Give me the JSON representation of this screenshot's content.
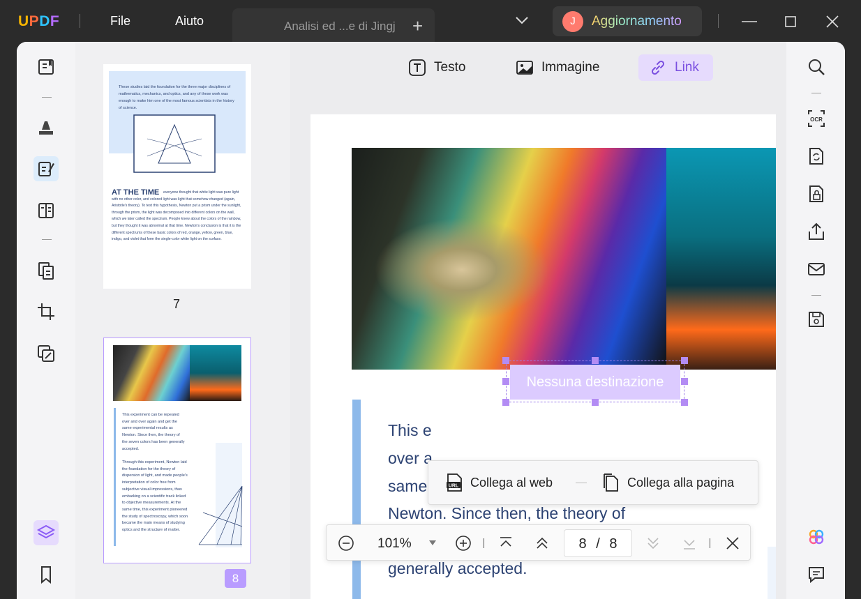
{
  "app": {
    "logo": "UPDF"
  },
  "menu": {
    "file": "File",
    "help": "Aiuto"
  },
  "tab": {
    "title": "Analisi ed ...e di Jingj",
    "add": "+"
  },
  "account": {
    "avatar_initial": "J",
    "upgrade_label": "Aggiornamento"
  },
  "toolbar": {
    "text_label": "Testo",
    "image_label": "Immagine",
    "link_label": "Link"
  },
  "thumbnails": {
    "page7": {
      "number": "7",
      "intro": "These studies laid the foundation for the three major disciplines of mathematics, mechanics, and optics, and any of these work was enough to make him one of the most famous scientists in the history of science.",
      "heading": "AT THE TIME",
      "body": "everyone thought that white light was pure light with no other color, and colored light was light that somehow changed (again, Aristotle's theory). To test this hypothesis, Newton put a prism under the sunlight, through the prism, the light was decomposed into different colors on the wall, which we later called the spectrum. People knew about the colors of the rainbow, but they thought it was abnormal at that time. Newton's conclusion is that it is the different spectrums of these basic colors of red, orange, yellow, green, blue, indigo, and violet that form the single-color white light on the surface."
    },
    "page8": {
      "number": "8",
      "para1": "This experiment can be repeated over and over again and get the same experimental results as Newton. Since then, the theory of the seven colors has been generally accepted.",
      "para2": "Through this experiment, Newton laid the foundation for the theory of dispersion of light, and made people's interpretation of color free from subjective visual impressions, thus embarking on a scientific track linked to objective measurements. At the same time, this experiment pioneered the study of spectroscopy, which soon became the main means of studying optics and the structure of matter."
    }
  },
  "document": {
    "lines": [
      "This e",
      "over a",
      "same experimental results as",
      "Newton. Since then, the theory of",
      "generally accepted."
    ],
    "link_placeholder": "Nessuna destinazione"
  },
  "link_popup": {
    "web": "Collega al web",
    "page": "Collega alla pagina"
  },
  "zoom": {
    "level": "101%",
    "current_page": "8",
    "separator": "/",
    "total_pages": "8"
  },
  "colors": {
    "accent": "#9b7ce8",
    "link_fill": "#dccbff",
    "page_badge": "#b99cff",
    "title_text": "#2d4373"
  }
}
